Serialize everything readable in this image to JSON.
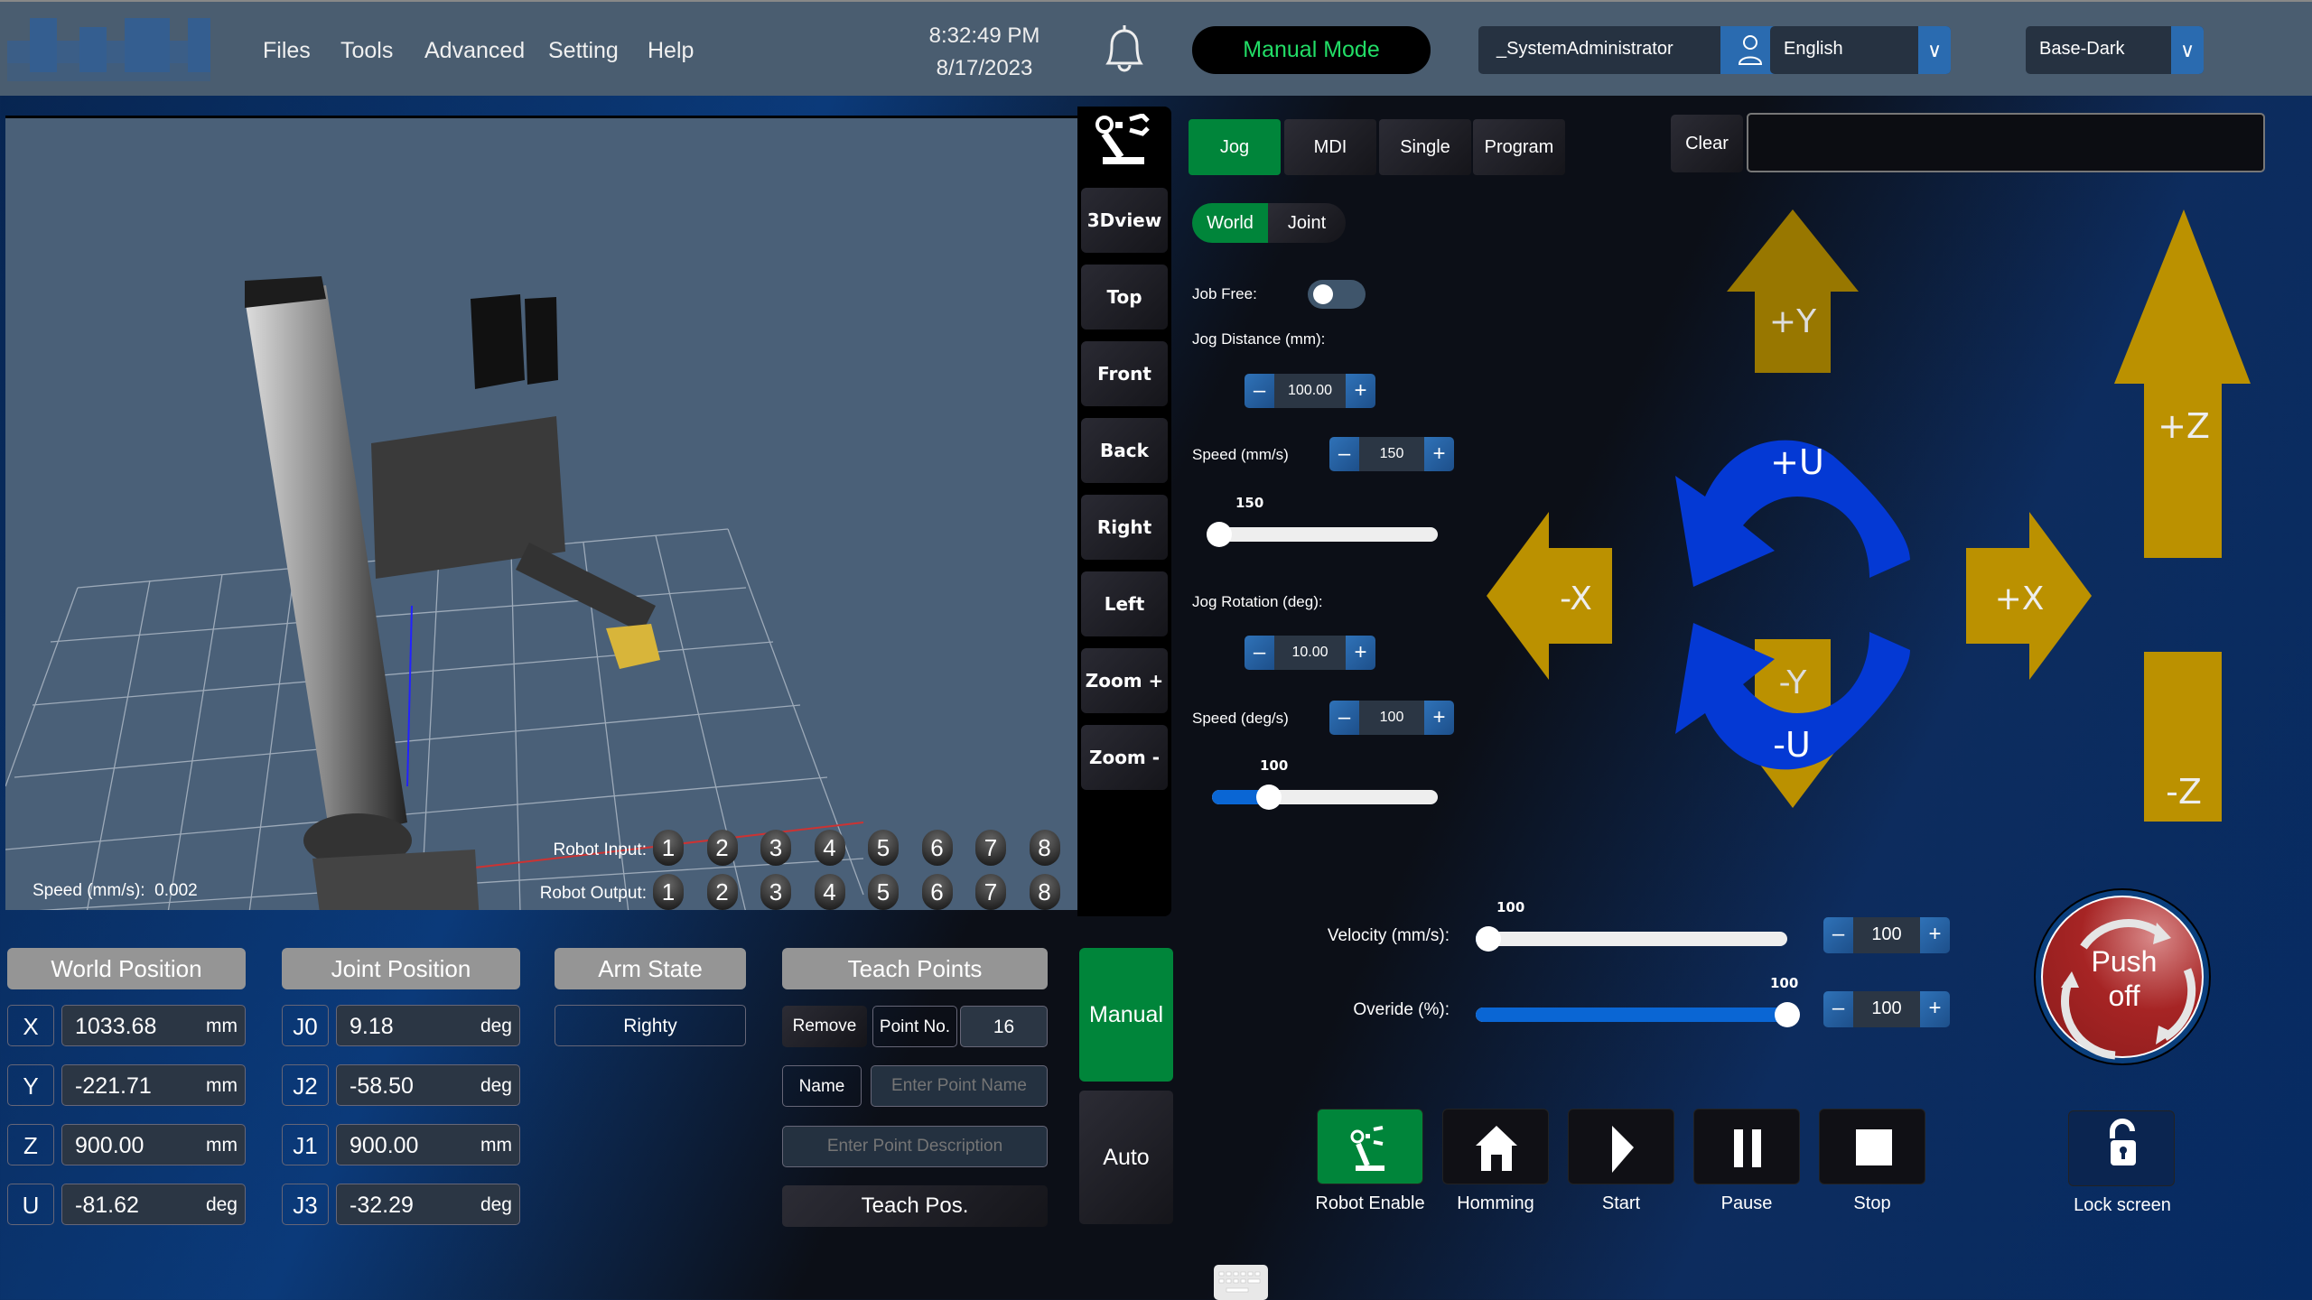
{
  "header": {
    "menu": [
      "Files",
      "Tools",
      "Advanced",
      "Setting",
      "Help"
    ],
    "time": "8:32:49 PM",
    "date": "8/17/2023",
    "mode": "Manual Mode",
    "user": "_SystemAdministrator",
    "language": "English",
    "theme": "Base-Dark",
    "icons": {
      "notifications": "bell-icon",
      "user": "user-icon",
      "dropdown": "chevron-down-icon"
    }
  },
  "viewport": {
    "view_buttons": [
      "3Dview",
      "Top",
      "Front",
      "Back",
      "Right",
      "Left",
      "Zoom +",
      "Zoom -"
    ],
    "speed_label": "Speed (mm/s):",
    "speed_value": "0.002",
    "robot_input_label": "Robot Input:",
    "robot_output_label": "Robot Output:",
    "inputs": [
      "1",
      "2",
      "3",
      "4",
      "5",
      "6",
      "7",
      "8"
    ],
    "outputs": [
      "1",
      "2",
      "3",
      "4",
      "5",
      "6",
      "7",
      "8"
    ]
  },
  "jog": {
    "tabs": [
      {
        "label": "Jog",
        "active": true
      },
      {
        "label": "MDI"
      },
      {
        "label": "Single"
      },
      {
        "label": "Program"
      }
    ],
    "clear_label": "Clear",
    "message_value": "",
    "frame_toggle": [
      "World",
      "Joint"
    ],
    "job_free_label": "Job Free:",
    "job_free_on": false,
    "jog_distance_label": "Jog Distance (mm):",
    "jog_distance_value": "100.00",
    "speed_mm_label": "Speed (mm/s)",
    "speed_mm_value": "150",
    "speed_mm_slider": 150,
    "speed_mm_slider_fraction": 0.03,
    "jog_rotation_label": "Jog Rotation (deg):",
    "jog_rotation_value": "10.00",
    "speed_deg_label": "Speed (deg/s)",
    "speed_deg_value": "100",
    "speed_deg_slider": 100,
    "speed_deg_slider_fraction": 0.25,
    "arrows": {
      "py": "+Y",
      "ny": "-Y",
      "px": "+X",
      "nx": "-X",
      "pz": "+Z",
      "nz": "-Z",
      "pu": "+U",
      "nu": "-U"
    },
    "colors": {
      "arrow": "#bb9100",
      "arrow_dim": "#987700",
      "rotate": "#0439d4",
      "active": "#00853a"
    }
  },
  "motion": {
    "velocity_label": "Velocity (mm/s):",
    "velocity_value": "100",
    "velocity_fraction": 0.04,
    "override_label": "Overide (%):",
    "override_value": "100",
    "override_fraction": 1.0,
    "estop_line1": "Push",
    "estop_line2": "off"
  },
  "actions": [
    {
      "label": "Robot Enable",
      "icon": "robot-arm-icon",
      "active": true
    },
    {
      "label": "Homming",
      "icon": "home-icon"
    },
    {
      "label": "Start",
      "icon": "play-icon"
    },
    {
      "label": "Pause",
      "icon": "pause-icon"
    },
    {
      "label": "Stop",
      "icon": "stop-icon"
    }
  ],
  "lock_label": "Lock screen",
  "world": {
    "title": "World Position",
    "rows": [
      {
        "axis": "X",
        "value": "1033.68",
        "unit": "mm"
      },
      {
        "axis": "Y",
        "value": "-221.71",
        "unit": "mm"
      },
      {
        "axis": "Z",
        "value": "900.00",
        "unit": "mm"
      },
      {
        "axis": "U",
        "value": "-81.62",
        "unit": "deg"
      }
    ]
  },
  "joint": {
    "title": "Joint Position",
    "rows": [
      {
        "axis": "J0",
        "value": "9.18",
        "unit": "deg"
      },
      {
        "axis": "J2",
        "value": "-58.50",
        "unit": "deg"
      },
      {
        "axis": "J1",
        "value": "900.00",
        "unit": "mm"
      },
      {
        "axis": "J3",
        "value": "-32.29",
        "unit": "deg"
      }
    ]
  },
  "arm": {
    "title": "Arm State",
    "value": "Righty"
  },
  "teach": {
    "title": "Teach Points",
    "remove_label": "Remove",
    "point_no_label": "Point No.",
    "point_no_value": "16",
    "name_label": "Name",
    "name_placeholder": "Enter Point Name",
    "desc_placeholder": "Enter Point Description",
    "teach_label": "Teach Pos."
  },
  "run_mode": {
    "manual": "Manual",
    "auto": "Auto",
    "active": "Manual"
  }
}
